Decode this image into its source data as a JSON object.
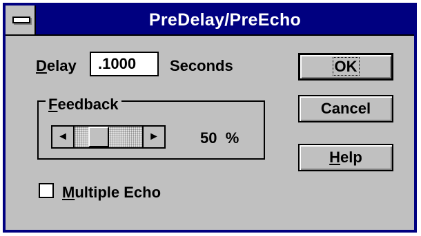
{
  "window": {
    "title": "PreDelay/PreEcho"
  },
  "delay": {
    "label_accel": "D",
    "label_rest": "elay",
    "value": ".1000",
    "units": "Seconds"
  },
  "feedback": {
    "group_accel": "F",
    "group_rest": "eedback",
    "value": "50",
    "unit": "%",
    "level_percent": 50,
    "left_arrow": "◄",
    "right_arrow": "►"
  },
  "buttons": {
    "ok": "OK",
    "cancel": "Cancel",
    "help_accel": "H",
    "help_rest": "elp"
  },
  "multiple_echo": {
    "accel": "M",
    "rest": "ultiple Echo",
    "checked": false
  },
  "colors": {
    "title_bar": "#000080",
    "face": "#c0c0c0"
  },
  "icons": {
    "system_menu": "system-menu-icon"
  }
}
